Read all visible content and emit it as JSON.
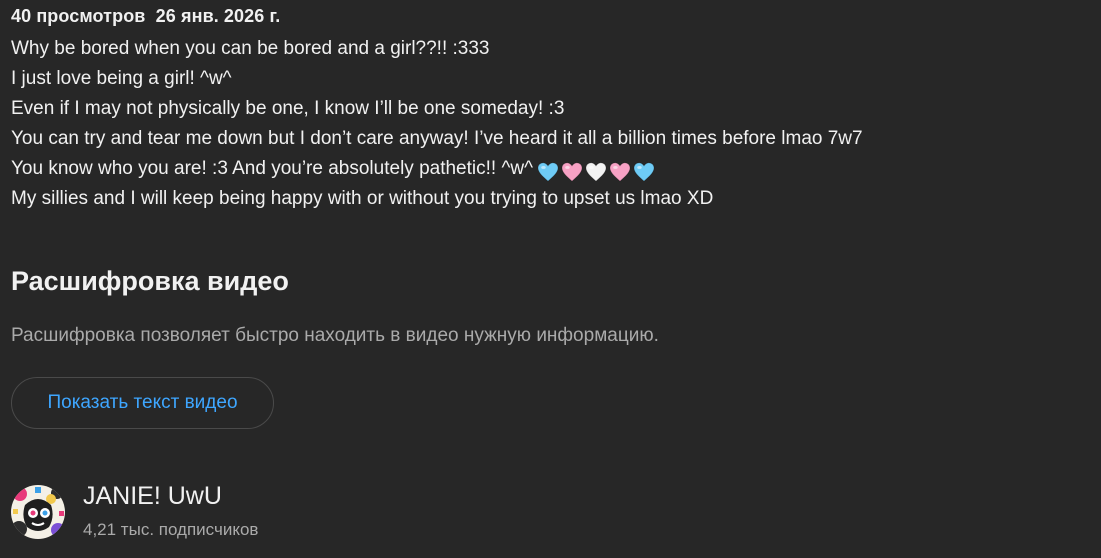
{
  "video_meta": {
    "views": "40 просмотров",
    "date": "26 янв. 2026 г."
  },
  "description": {
    "lines": [
      "Why be bored when you can be bored and a girl??!! :333",
      "I just love being a girl! ^w^",
      "Even if I may not physically be one, I know I’ll be one someday! :3",
      "You can try and tear me down but I don’t care anyway! I’ve heard it all a billion times before lmao 7w7",
      "You know who you are! :3 And you’re absolutely pathetic!! ^w^",
      "My sillies and I will keep being happy with or without you trying to upset us lmao XD"
    ],
    "heart_emojis": [
      "light-blue-heart",
      "pink-heart",
      "white-heart",
      "pink-heart",
      "light-blue-heart"
    ],
    "heart_colors": [
      "#6ecbf5",
      "#f7a1c4",
      "#f2f2f2",
      "#f7a1c4",
      "#6ecbf5"
    ]
  },
  "transcript": {
    "title": "Расшифровка видео",
    "subtitle": "Расшифровка позволяет быстро находить в видео нужную информацию.",
    "button_label": "Показать текст видео",
    "button_color": "#3ea6ff"
  },
  "channel": {
    "name": "JANIE! UwU",
    "subscribers": "4,21 тыс. подписчиков"
  }
}
